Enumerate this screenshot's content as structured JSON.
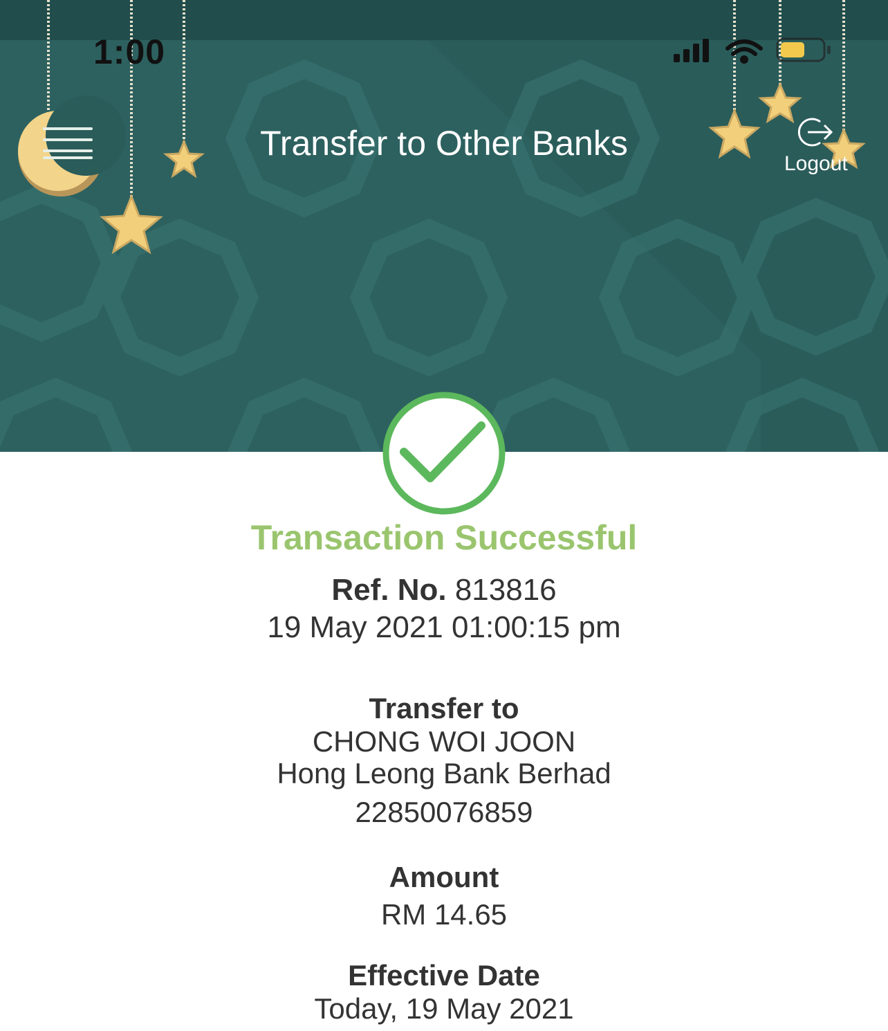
{
  "status_bar": {
    "time": "1:00",
    "battery_color": "#f2c94c"
  },
  "header": {
    "title": "Transfer to Other Banks",
    "logout_label": "Logout",
    "menu_icon": "hamburger-menu-icon",
    "logout_icon": "logout-arrow-icon",
    "background_color": "#2a5c5a"
  },
  "result": {
    "status_text": "Transaction Successful",
    "status_color": "#9ac56e",
    "check_color": "#5cb85c",
    "ref_label": "Ref. No.",
    "ref_number": "813816",
    "datetime": "19 May 2021 01:00:15 pm"
  },
  "details": {
    "transfer_to_label": "Transfer to",
    "recipient_name": "CHONG WOI JOON",
    "bank_name": "Hong Leong Bank Berhad",
    "account_number": "22850076859",
    "amount_label": "Amount",
    "amount_value": "RM 14.65",
    "effective_date_label": "Effective Date",
    "effective_date_value": "Today, 19 May 2021"
  }
}
